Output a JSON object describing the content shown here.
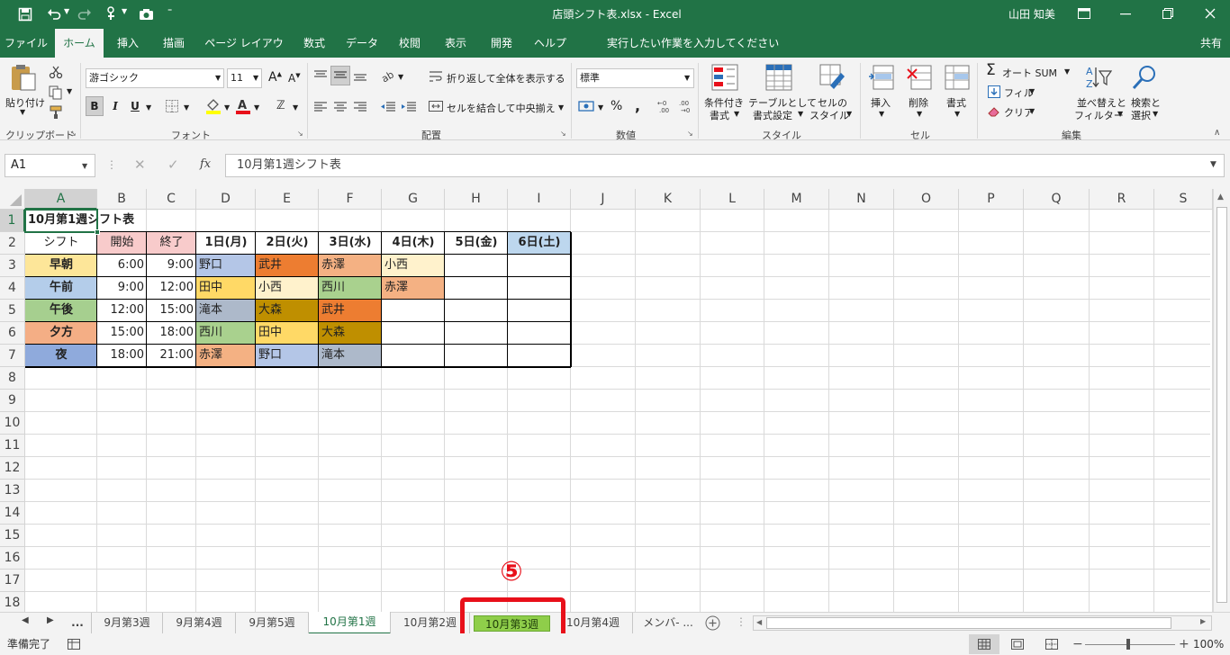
{
  "title_bar": {
    "document_title": "店頭シフト表.xlsx  -  Excel",
    "user_name": "山田 知美"
  },
  "ribbon_tabs": [
    "ファイル",
    "ホーム",
    "挿入",
    "描画",
    "ページ レイアウト",
    "数式",
    "データ",
    "校閲",
    "表示",
    "開発",
    "ヘルプ"
  ],
  "active_tab": "ホーム",
  "tell_me": "実行したい作業を入力してください",
  "share_label": "共有",
  "ribbon": {
    "clipboard": {
      "paste": "貼り付け",
      "group": "クリップボード"
    },
    "font": {
      "font_name": "游ゴシック",
      "font_size": "11",
      "bold": "B",
      "italic": "I",
      "underline": "U",
      "group": "フォント"
    },
    "alignment": {
      "wrap": "折り返して全体を表示する",
      "merge": "セルを結合して中央揃え",
      "group": "配置"
    },
    "number": {
      "format": "標準",
      "percent": "%",
      "comma": ",",
      "group": "数値"
    },
    "styles": {
      "conditional_1": "条件付き",
      "conditional_2": "書式",
      "table_1": "テーブルとして",
      "table_2": "書式設定",
      "cell_1": "セルの",
      "cell_2": "スタイル",
      "group": "スタイル"
    },
    "cells": {
      "insert": "挿入",
      "delete": "削除",
      "format": "書式",
      "group": "セル"
    },
    "editing": {
      "autosum": "オート SUM",
      "fill": "フィル",
      "clear": "クリア",
      "sort_1": "並べ替えと",
      "sort_2": "フィルター",
      "find_1": "検索と",
      "find_2": "選択",
      "group": "編集"
    }
  },
  "formula_bar": {
    "name_box": "A1",
    "fx": "fx",
    "content": "10月第1週シフト表"
  },
  "columns": [
    "A",
    "B",
    "C",
    "D",
    "E",
    "F",
    "G",
    "H",
    "I",
    "J",
    "K",
    "L",
    "M",
    "N",
    "O",
    "P",
    "Q",
    "R",
    "S"
  ],
  "rows": [
    "1",
    "2",
    "3",
    "4",
    "5",
    "6",
    "7",
    "8",
    "9",
    "10",
    "11",
    "12",
    "13",
    "14",
    "15",
    "16",
    "17",
    "18"
  ],
  "sheet": {
    "title": "10月第1週シフト表",
    "header": [
      "シフト",
      "開始",
      "終了",
      "1日(月)",
      "2日(火)",
      "3日(水)",
      "4日(木)",
      "5日(金)",
      "6日(土)"
    ],
    "data": [
      [
        "早朝",
        "6:00",
        "9:00",
        "野口",
        "武井",
        "赤澤",
        "小西",
        "",
        ""
      ],
      [
        "午前",
        "9:00",
        "12:00",
        "田中",
        "小西",
        "西川",
        "赤澤",
        "",
        ""
      ],
      [
        "午後",
        "12:00",
        "15:00",
        "滝本",
        "大森",
        "武井",
        "",
        "",
        ""
      ],
      [
        "夕方",
        "15:00",
        "18:00",
        "西川",
        "田中",
        "大森",
        "",
        "",
        ""
      ],
      [
        "夜",
        "18:00",
        "21:00",
        "赤澤",
        "野口",
        "滝本",
        "",
        "",
        ""
      ]
    ]
  },
  "sheet_tabs": [
    "...",
    "9月第3週",
    "9月第4週",
    "9月第5週",
    "10月第1週",
    "10月第2週",
    "10月第3週",
    "10月第4週",
    "メンバ- ..."
  ],
  "active_sheet": "10月第1週",
  "annotation": {
    "marker": "⑤"
  },
  "status": {
    "ready": "準備完了",
    "zoom": "100%"
  },
  "colors": {
    "excel_green": "#217346",
    "highlight_red": "#e8101a",
    "tab_highlight": "#8fce4a"
  }
}
